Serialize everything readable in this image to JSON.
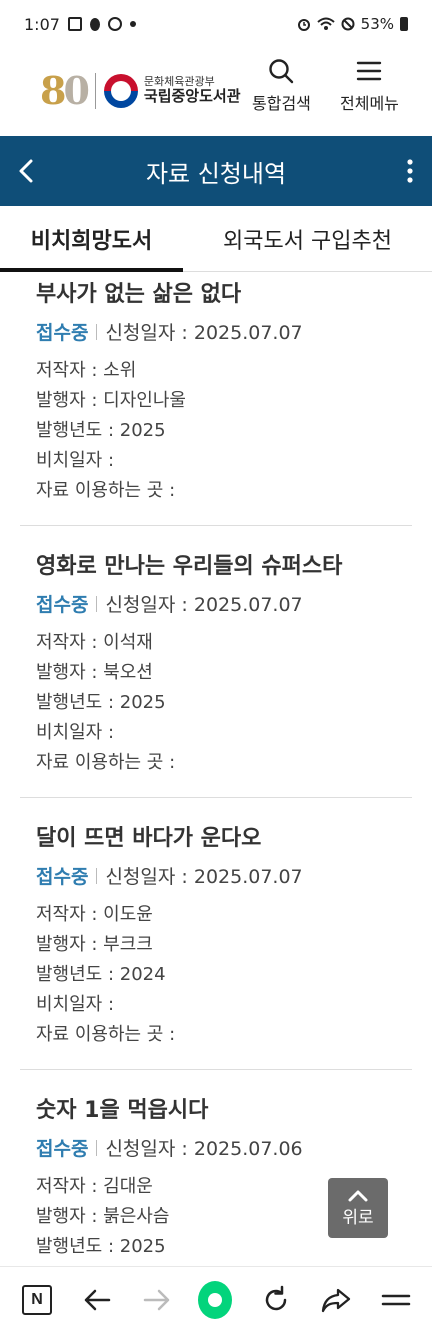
{
  "status_bar": {
    "time": "1:07",
    "battery": "53%"
  },
  "header": {
    "logo_number_1": "8",
    "logo_number_2": "0",
    "logo_line1": "문화체육관광부",
    "logo_line2": "국립중앙도서관",
    "search_label": "통합검색",
    "menu_label": "전체메뉴"
  },
  "titlebar": {
    "title": "자료 신청내역"
  },
  "tabs": [
    {
      "label": "비치희망도서"
    },
    {
      "label": "외국도서 구입추천"
    }
  ],
  "items": [
    {
      "title": "부사가 없는 삶은 없다",
      "status": "접수중",
      "date": "신청일자 : 2025.07.07",
      "author": "저작자 : 소위",
      "publisher": "발행자 : 디자인나울",
      "year": "발행년도 : 2025",
      "placed": "비치일자 :",
      "location": "자료 이용하는 곳 :"
    },
    {
      "title": "영화로 만나는 우리들의 슈퍼스타",
      "status": "접수중",
      "date": "신청일자 : 2025.07.07",
      "author": "저작자 : 이석재",
      "publisher": "발행자 : 북오션",
      "year": "발행년도 : 2025",
      "placed": "비치일자 :",
      "location": "자료 이용하는 곳 :"
    },
    {
      "title": "달이 뜨면 바다가 운다오",
      "status": "접수중",
      "date": "신청일자 : 2025.07.07",
      "author": "저작자 : 이도윤",
      "publisher": "발행자 : 부크크",
      "year": "발행년도 : 2024",
      "placed": "비치일자 :",
      "location": "자료 이용하는 곳 :"
    },
    {
      "title": "숫자 1을 먹읍시다",
      "status": "접수중",
      "date": "신청일자 : 2025.07.06",
      "author": "저작자 : 김대운",
      "publisher": "발행자 : 붉은사슴",
      "year": "발행년도 : 2025"
    }
  ],
  "top_button": {
    "label": "위로"
  },
  "browser_bar": {
    "n_label": "N"
  }
}
